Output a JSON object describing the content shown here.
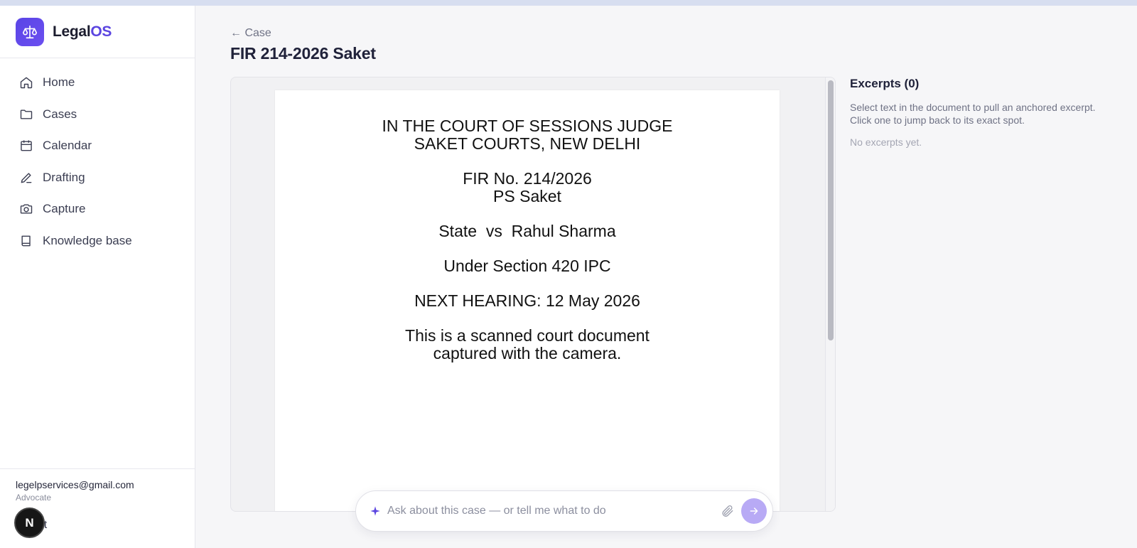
{
  "app": {
    "name_prefix": "Legal",
    "name_suffix": "OS",
    "brand_color": "#5b45e0"
  },
  "sidebar": {
    "items": [
      {
        "label": "Home",
        "icon": "home-icon"
      },
      {
        "label": "Cases",
        "icon": "folder-icon"
      },
      {
        "label": "Calendar",
        "icon": "calendar-icon"
      },
      {
        "label": "Drafting",
        "icon": "pen-icon"
      },
      {
        "label": "Capture",
        "icon": "camera-icon"
      },
      {
        "label": "Knowledge base",
        "icon": "book-icon"
      }
    ],
    "account": {
      "email": "legelpservices@gmail.com",
      "role": "Advocate",
      "logout_label": "out",
      "badge_letter": "N"
    }
  },
  "header": {
    "back_label": "← Case",
    "title": "FIR 214-2026 Saket"
  },
  "document": {
    "lines": [
      [
        "IN THE COURT OF SESSIONS JUDGE",
        "SAKET COURTS, NEW DELHI"
      ],
      [
        "FIR No. 214/2026",
        "PS Saket"
      ],
      [
        "State  vs  Rahul Sharma"
      ],
      [
        "Under Section 420 IPC"
      ],
      [
        "NEXT HEARING: 12 May 2026"
      ],
      [
        "This is a scanned court document",
        "captured with the camera."
      ]
    ]
  },
  "chat": {
    "placeholder": "Ask about this case — or tell me what to do",
    "send_color": "#b8aaf5"
  },
  "excerpts": {
    "title": "Excerpts (0)",
    "description": "Select text in the document to pull an anchored excerpt. Click one to jump back to its exact spot.",
    "empty": "No excerpts yet."
  }
}
